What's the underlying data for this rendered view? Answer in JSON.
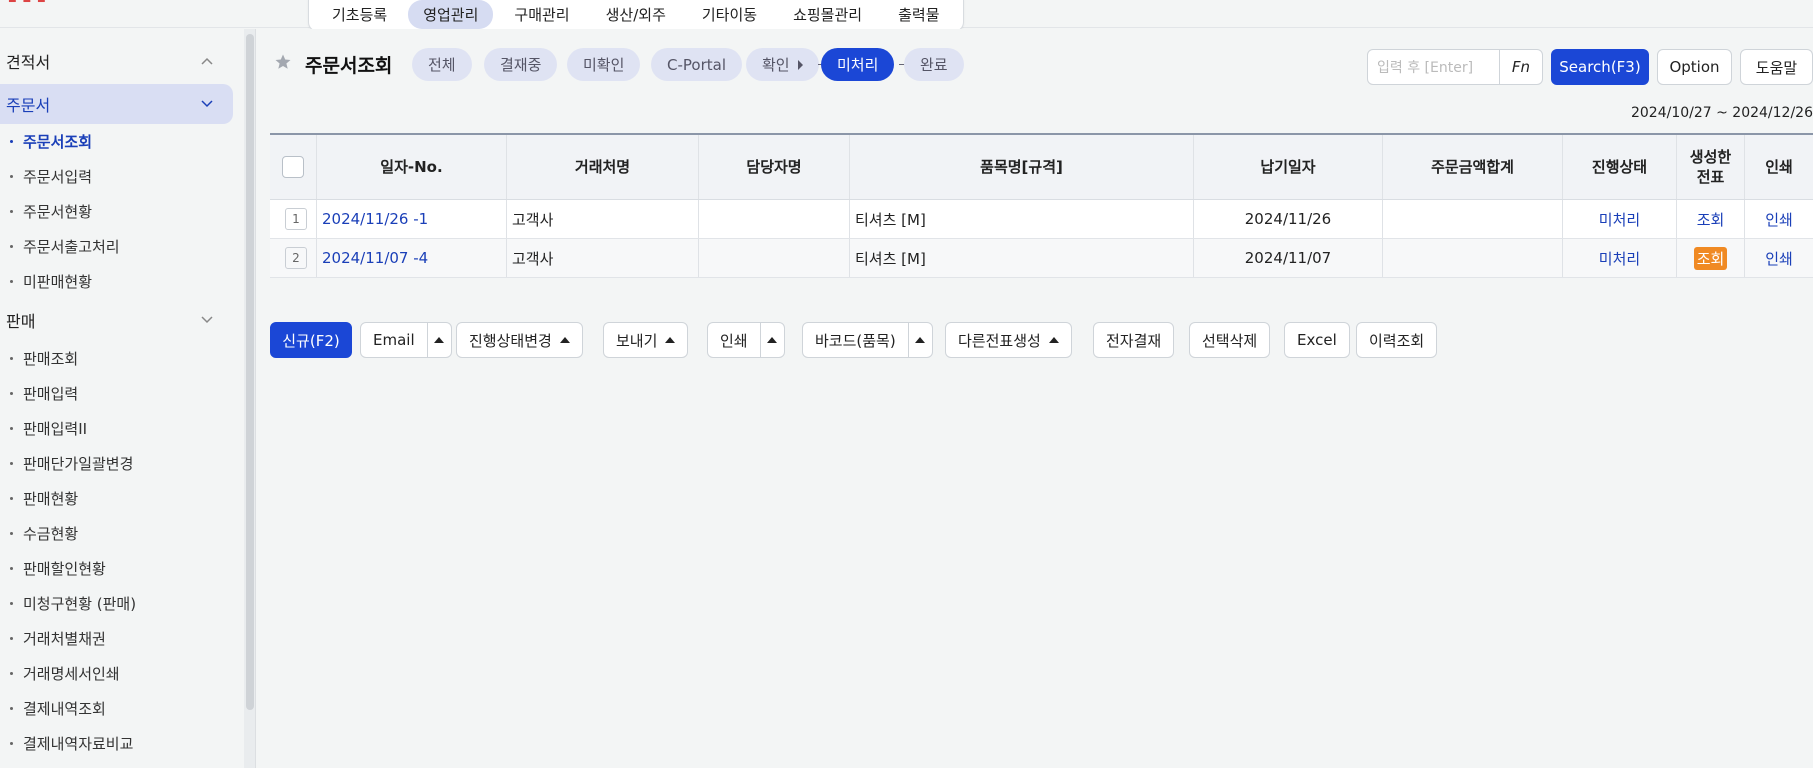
{
  "menu_tabs": [
    "기초등록",
    "영업관리",
    "구매관리",
    "생산/외주",
    "기타이동",
    "쇼핑몰관리",
    "출력물"
  ],
  "menu_active": "영업관리",
  "sidebar": {
    "sections": [
      {
        "label": "견적서"
      },
      {
        "label": "주문서"
      },
      {
        "label": "판매"
      }
    ],
    "order_items": [
      "주문서조회",
      "주문서입력",
      "주문서현황",
      "주문서출고처리",
      "미판매현황"
    ],
    "sales_items": [
      "판매조회",
      "판매입력",
      "판매입력II",
      "판매단가일괄변경",
      "판매현황",
      "수금현황",
      "판매할인현황",
      "미청구현황 (판매)",
      "거래처별채권",
      "거래명세서인쇄",
      "결제내역조회",
      "결제내역자료비교"
    ]
  },
  "page": {
    "title": "주문서조회",
    "status_filters": [
      "전체",
      "결재중",
      "미확인",
      "C-Portal",
      "확인",
      "미처리",
      "완료"
    ],
    "active_filter": "미처리",
    "search_placeholder": "입력 후 [Enter]",
    "fn_label": "Fn",
    "search_label": "Search(F3)",
    "option_label": "Option",
    "help_label": "도움말",
    "date_range": "2024/10/27 ~ 2024/12/26"
  },
  "table": {
    "headers": {
      "no": "일자-No.",
      "customer": "거래처명",
      "manager": "담당자명",
      "item": "품목명[규격]",
      "due": "납기일자",
      "amount": "주문금액합계",
      "status": "진행상태",
      "doc": "생성한\n전표",
      "print": "인쇄"
    },
    "rows": [
      {
        "num": "1",
        "no": "2024/11/26 -1",
        "customer": "고객사",
        "manager": "",
        "item": "티셔츠 [M]",
        "due": "2024/11/26",
        "amount": "",
        "status": "미처리",
        "doc": "조회",
        "print": "인쇄"
      },
      {
        "num": "2",
        "no": "2024/11/07 -4",
        "customer": "고객사",
        "manager": "",
        "item": "티셔츠 [M]",
        "due": "2024/11/07",
        "amount": "",
        "status": "미처리",
        "doc": "조회",
        "print": "인쇄"
      }
    ]
  },
  "actions": {
    "new": "신규(F2)",
    "email": "Email",
    "status_change": "진행상태변경",
    "send": "보내기",
    "print": "인쇄",
    "barcode": "바코드(품목)",
    "other_doc": "다른전표생성",
    "e_approval": "전자결재",
    "delete_selected": "선택삭제",
    "excel": "Excel",
    "history": "이력조회"
  },
  "colors": {
    "accent": "#1b47d6",
    "highlight": "#f08a24",
    "link": "#1a3fb8"
  }
}
